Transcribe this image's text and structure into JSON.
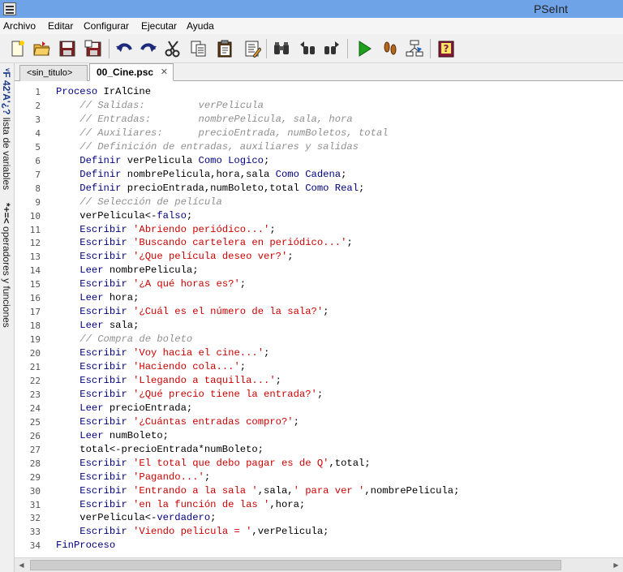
{
  "window": {
    "title": "PSeInt"
  },
  "menu": [
    "Archivo",
    "Editar",
    "Configurar",
    "Ejecutar",
    "Ayuda"
  ],
  "toolbar": {
    "buttons": [
      "new-file-icon",
      "open-folder-icon",
      "save-icon",
      "save-as-icon",
      "undo-icon",
      "redo-icon",
      "cut-icon",
      "copy-icon",
      "paste-icon",
      "corrector-icon",
      "search-icon",
      "search-prev-icon",
      "search-next-icon",
      "run-icon",
      "step-by-step-icon",
      "diagram-icon",
      "help-icon"
    ]
  },
  "side_panel": {
    "variables_label": "lista de variables",
    "variables_icon": "ᵛF 42'A'¿?",
    "operators_label": "operadores y funciones",
    "operators_icon": "*+=<"
  },
  "tabs": [
    {
      "label": "<sin_titulo>",
      "active": false
    },
    {
      "label": "00_Cine.psc",
      "active": true,
      "close": "✕"
    }
  ],
  "colors": {
    "keyword": "#000080",
    "string": "#cc0000",
    "comment": "#909090"
  },
  "code": [
    [
      [
        "kw",
        "Proceso"
      ],
      [
        "op",
        " IrAlCine"
      ]
    ],
    [
      [
        "cmt",
        "    // Salidas:         verPelicula"
      ]
    ],
    [
      [
        "cmt",
        "    // Entradas:        nombrePelicula, sala, hora"
      ]
    ],
    [
      [
        "cmt",
        "    // Auxiliares:      precioEntrada, numBoletos, total"
      ]
    ],
    [
      [
        "cmt",
        "    // Definición de entradas, auxiliares y salidas"
      ]
    ],
    [
      [
        "op",
        "    "
      ],
      [
        "kw",
        "Definir"
      ],
      [
        "op",
        " verPelicula "
      ],
      [
        "kw",
        "Como Logico"
      ],
      [
        "op",
        ";"
      ]
    ],
    [
      [
        "op",
        "    "
      ],
      [
        "kw",
        "Definir"
      ],
      [
        "op",
        " nombrePelicula,hora,sala "
      ],
      [
        "kw",
        "Como Cadena"
      ],
      [
        "op",
        ";"
      ]
    ],
    [
      [
        "op",
        "    "
      ],
      [
        "kw",
        "Definir"
      ],
      [
        "op",
        " precioEntrada,numBoleto,total "
      ],
      [
        "kw",
        "Como Real"
      ],
      [
        "op",
        ";"
      ]
    ],
    [
      [
        "cmt",
        "    // Selección de película"
      ]
    ],
    [
      [
        "op",
        "    verPelicula<-"
      ],
      [
        "kw",
        "falso"
      ],
      [
        "op",
        ";"
      ]
    ],
    [
      [
        "op",
        "    "
      ],
      [
        "kw",
        "Escribir"
      ],
      [
        "op",
        " "
      ],
      [
        "str",
        "'Abriendo periódico...'"
      ],
      [
        "op",
        ";"
      ]
    ],
    [
      [
        "op",
        "    "
      ],
      [
        "kw",
        "Escribir"
      ],
      [
        "op",
        " "
      ],
      [
        "str",
        "'Buscando cartelera en periódico...'"
      ],
      [
        "op",
        ";"
      ]
    ],
    [
      [
        "op",
        "    "
      ],
      [
        "kw",
        "Escribir"
      ],
      [
        "op",
        " "
      ],
      [
        "str",
        "'¿Que película deseo ver?'"
      ],
      [
        "op",
        ";"
      ]
    ],
    [
      [
        "op",
        "    "
      ],
      [
        "kw",
        "Leer"
      ],
      [
        "op",
        " nombrePelicula;"
      ]
    ],
    [
      [
        "op",
        "    "
      ],
      [
        "kw",
        "Escribir"
      ],
      [
        "op",
        " "
      ],
      [
        "str",
        "'¿A qué horas es?'"
      ],
      [
        "op",
        ";"
      ]
    ],
    [
      [
        "op",
        "    "
      ],
      [
        "kw",
        "Leer"
      ],
      [
        "op",
        " hora;"
      ]
    ],
    [
      [
        "op",
        "    "
      ],
      [
        "kw",
        "Escribir"
      ],
      [
        "op",
        " "
      ],
      [
        "str",
        "'¿Cuál es el número de la sala?'"
      ],
      [
        "op",
        ";"
      ]
    ],
    [
      [
        "op",
        "    "
      ],
      [
        "kw",
        "Leer"
      ],
      [
        "op",
        " sala;"
      ]
    ],
    [
      [
        "cmt",
        "    // Compra de boleto"
      ]
    ],
    [
      [
        "op",
        "    "
      ],
      [
        "kw",
        "Escribir"
      ],
      [
        "op",
        " "
      ],
      [
        "str",
        "'Voy hacia el cine...'"
      ],
      [
        "op",
        ";"
      ]
    ],
    [
      [
        "op",
        "    "
      ],
      [
        "kw",
        "Escribir"
      ],
      [
        "op",
        " "
      ],
      [
        "str",
        "'Haciendo cola...'"
      ],
      [
        "op",
        ";"
      ]
    ],
    [
      [
        "op",
        "    "
      ],
      [
        "kw",
        "Escribir"
      ],
      [
        "op",
        " "
      ],
      [
        "str",
        "'Llegando a taquilla...'"
      ],
      [
        "op",
        ";"
      ]
    ],
    [
      [
        "op",
        "    "
      ],
      [
        "kw",
        "Escribir"
      ],
      [
        "op",
        " "
      ],
      [
        "str",
        "'¿Qué precio tiene la entrada?'"
      ],
      [
        "op",
        ";"
      ]
    ],
    [
      [
        "op",
        "    "
      ],
      [
        "kw",
        "Leer"
      ],
      [
        "op",
        " precioEntrada;"
      ]
    ],
    [
      [
        "op",
        "    "
      ],
      [
        "kw",
        "Escribir"
      ],
      [
        "op",
        " "
      ],
      [
        "str",
        "'¿Cuántas entradas compro?'"
      ],
      [
        "op",
        ";"
      ]
    ],
    [
      [
        "op",
        "    "
      ],
      [
        "kw",
        "Leer"
      ],
      [
        "op",
        " numBoleto;"
      ]
    ],
    [
      [
        "op",
        "    total<-precioEntrada*numBoleto;"
      ]
    ],
    [
      [
        "op",
        "    "
      ],
      [
        "kw",
        "Escribir"
      ],
      [
        "op",
        " "
      ],
      [
        "str",
        "'El total que debo pagar es de Q'"
      ],
      [
        "op",
        ",total;"
      ]
    ],
    [
      [
        "op",
        "    "
      ],
      [
        "kw",
        "Escribir"
      ],
      [
        "op",
        " "
      ],
      [
        "str",
        "'Pagando...'"
      ],
      [
        "op",
        ";"
      ]
    ],
    [
      [
        "op",
        "    "
      ],
      [
        "kw",
        "Escribir"
      ],
      [
        "op",
        " "
      ],
      [
        "str",
        "'Entrando a la sala '"
      ],
      [
        "op",
        ",sala,"
      ],
      [
        "str",
        "' para ver '"
      ],
      [
        "op",
        ",nombrePelicula;"
      ]
    ],
    [
      [
        "op",
        "    "
      ],
      [
        "kw",
        "Escribir"
      ],
      [
        "op",
        " "
      ],
      [
        "str",
        "'en la función de las '"
      ],
      [
        "op",
        ",hora;"
      ]
    ],
    [
      [
        "op",
        "    verPelicula<-"
      ],
      [
        "kw",
        "verdadero"
      ],
      [
        "op",
        ";"
      ]
    ],
    [
      [
        "op",
        "    "
      ],
      [
        "kw",
        "Escribir"
      ],
      [
        "op",
        " "
      ],
      [
        "str",
        "'Viendo pelicula = '"
      ],
      [
        "op",
        ",verPelicula;"
      ]
    ],
    [
      [
        "kw",
        "FinProceso"
      ]
    ]
  ]
}
